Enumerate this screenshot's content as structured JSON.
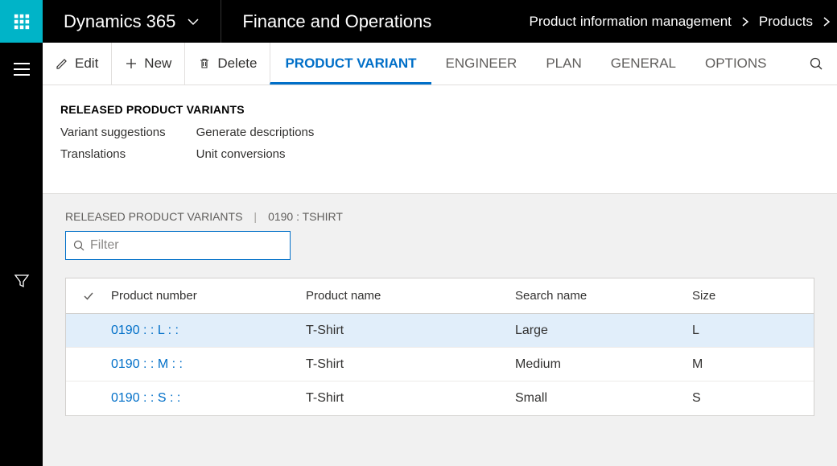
{
  "header": {
    "brand": "Dynamics 365",
    "module": "Finance and Operations",
    "breadcrumb": [
      "Product information management",
      "Products"
    ]
  },
  "actions": {
    "edit": "Edit",
    "new": "New",
    "delete": "Delete"
  },
  "tabs": [
    "PRODUCT VARIANT",
    "ENGINEER",
    "PLAN",
    "GENERAL",
    "OPTIONS"
  ],
  "active_tab": 0,
  "group": {
    "title": "RELEASED PRODUCT VARIANTS",
    "col1": [
      "Variant suggestions",
      "Translations"
    ],
    "col2": [
      "Generate descriptions",
      "Unit conversions"
    ]
  },
  "grid": {
    "caption": "RELEASED PRODUCT VARIANTS",
    "context": "0190 : TSHIRT",
    "filter_placeholder": "Filter",
    "columns": [
      "Product number",
      "Product name",
      "Search name",
      "Size"
    ],
    "rows": [
      {
        "selected": true,
        "number": "0190 :  : L :  :",
        "name": "T-Shirt",
        "search": "Large",
        "size": "L"
      },
      {
        "selected": false,
        "number": "0190 :  : M :  :",
        "name": "T-Shirt",
        "search": "Medium",
        "size": "M"
      },
      {
        "selected": false,
        "number": "0190 :  : S :  :",
        "name": "T-Shirt",
        "search": "Small",
        "size": "S"
      }
    ]
  }
}
